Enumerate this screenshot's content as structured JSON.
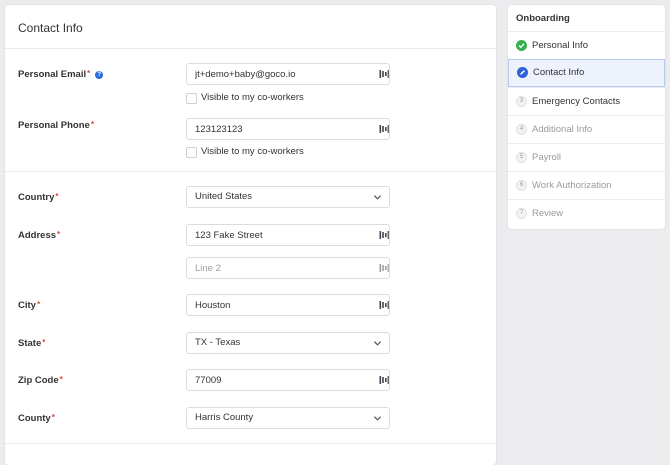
{
  "form": {
    "title": "Contact Info",
    "fields": {
      "personal_email": {
        "label": "Personal Email",
        "value": "jt+demo+baby@goco.io"
      },
      "email_visible": {
        "label": "Visible to my co-workers",
        "checked": false
      },
      "personal_phone": {
        "label": "Personal Phone",
        "value": "123123123"
      },
      "phone_visible": {
        "label": "Visible to my co-workers",
        "checked": false
      },
      "country": {
        "label": "Country",
        "value": "United States"
      },
      "address": {
        "label": "Address",
        "value": "123 Fake Street",
        "line2_placeholder": "Line 2"
      },
      "city": {
        "label": "City",
        "value": "Houston"
      },
      "state": {
        "label": "State",
        "value": "TX - Texas"
      },
      "zip": {
        "label": "Zip Code",
        "value": "77009"
      },
      "county": {
        "label": "County",
        "value": "Harris County"
      }
    },
    "required_mark": "*",
    "help_glyph": "?"
  },
  "sidebar": {
    "title": "Onboarding",
    "steps": [
      {
        "label": "Personal Info",
        "status": "done"
      },
      {
        "label": "Contact Info",
        "status": "current"
      },
      {
        "label": "Emergency Contacts",
        "status": "todo",
        "number": "3"
      },
      {
        "label": "Additional Info",
        "status": "disabled",
        "number": "4"
      },
      {
        "label": "Payroll",
        "status": "disabled",
        "number": "5"
      },
      {
        "label": "Work Authorization",
        "status": "disabled",
        "number": "6"
      },
      {
        "label": "Review",
        "status": "disabled",
        "number": "7"
      }
    ]
  },
  "colors": {
    "accent": "#2d63d6",
    "done": "#37b04f",
    "required": "#e0433a",
    "active_step_bg": "#eef2fd"
  },
  "icons": {
    "field_action": "keyboard-icon",
    "select": "chevron-down-icon",
    "done_step": "checkmark-icon",
    "current_step": "pencil-icon"
  }
}
